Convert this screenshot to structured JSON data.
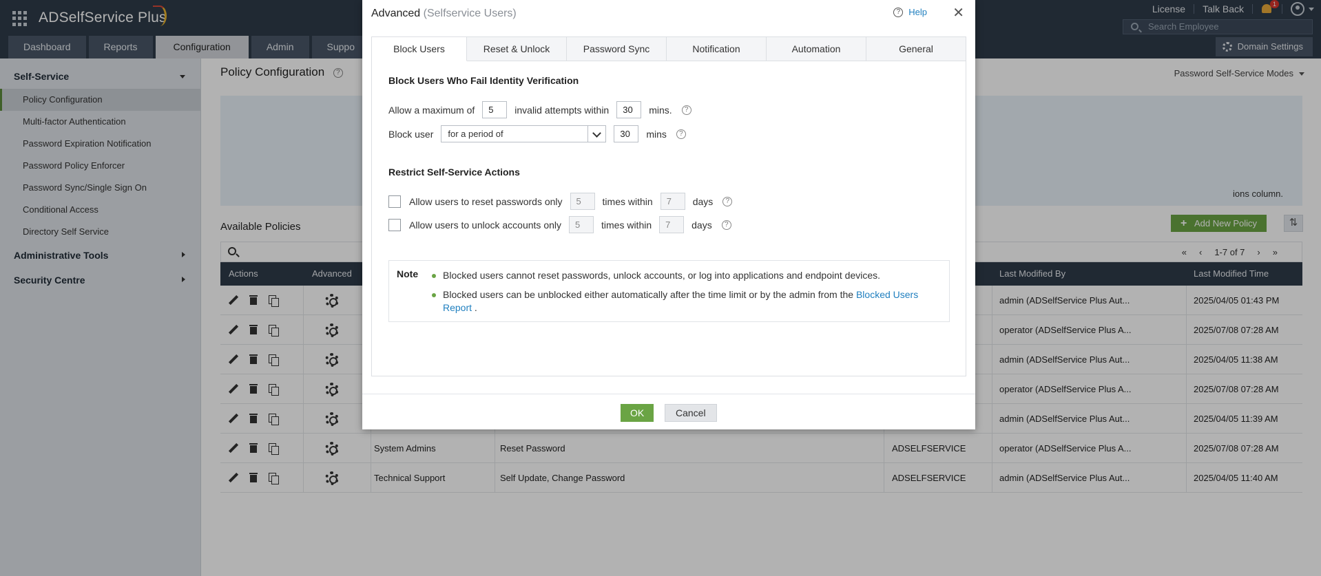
{
  "app": {
    "title": "ADSelfService Plus"
  },
  "topbar": {
    "links": [
      "License",
      "Talk Back"
    ],
    "notification_count": "1",
    "search_placeholder": "Search Employee",
    "tabs": [
      "Dashboard",
      "Reports",
      "Configuration",
      "Admin",
      "Suppo"
    ],
    "active_tab": "Configuration",
    "domain_settings": "Domain Settings"
  },
  "sidebar": {
    "self_service": "Self-Service",
    "items": [
      "Policy Configuration",
      "Multi-factor Authentication",
      "Password Expiration Notification",
      "Password Policy Enforcer",
      "Password Sync/Single Sign On",
      "Conditional Access",
      "Directory Self Service"
    ],
    "administrative_tools": "Administrative Tools",
    "security_centre": "Security Centre"
  },
  "main": {
    "title": "Policy Configuration",
    "modes_dropdown": "Password Self-Service Modes",
    "info_tail": "ions column.",
    "available_policies": "Available Policies",
    "add_policy": "Add New Policy",
    "pagination": "1-7 of 7",
    "columns": [
      "Actions",
      "Advanced",
      "Last Modified By",
      "Last Modified Time"
    ],
    "rows": [
      {
        "name": "",
        "features": "",
        "domain": "",
        "modified_by": "admin (ADSelfService Plus Aut...",
        "modified_time": "2025/04/05 01:43 PM"
      },
      {
        "name": "",
        "features": "",
        "domain": "",
        "modified_by": "operator (ADSelfService Plus A...",
        "modified_time": "2025/07/08 07:28 AM"
      },
      {
        "name": "",
        "features": "",
        "domain": "",
        "modified_by": "admin (ADSelfService Plus Aut...",
        "modified_time": "2025/04/05 11:38 AM"
      },
      {
        "name": "",
        "features": "",
        "domain": "",
        "modified_by": "operator (ADSelfService Plus A...",
        "modified_time": "2025/07/08 07:28 AM"
      },
      {
        "name": "",
        "features": "",
        "domain": "",
        "modified_by": "admin (ADSelfService Plus Aut...",
        "modified_time": "2025/04/05 11:39 AM"
      },
      {
        "name": "System Admins",
        "features": "Reset Password",
        "domain": "ADSELFSERVICE",
        "modified_by": "operator (ADSelfService Plus A...",
        "modified_time": "2025/07/08 07:28 AM"
      },
      {
        "name": "Technical Support",
        "features": "Self Update, Change Password",
        "domain": "ADSELFSERVICE",
        "modified_by": "admin (ADSelfService Plus Aut...",
        "modified_time": "2025/04/05 11:40 AM"
      }
    ]
  },
  "dialog": {
    "title": "Advanced",
    "subtitle": "(Selfservice Users)",
    "help": "Help",
    "tabs": [
      "Block Users",
      "Reset & Unlock",
      "Password Sync",
      "Notification",
      "Automation",
      "General"
    ],
    "active_tab": "Block Users",
    "block": {
      "heading": "Block Users Who Fail Identity Verification",
      "allow_prefix": "Allow a maximum of",
      "attempts": "5",
      "attempts_mid": "invalid attempts within",
      "minutes": "30",
      "mins_dot": "mins.",
      "block_user": "Block user",
      "period_option": "for a period of",
      "period_minutes": "30",
      "mins": "mins"
    },
    "restrict": {
      "heading": "Restrict Self-Service Actions",
      "reset_label": "Allow users to reset passwords only",
      "reset_times": "5",
      "times_within": "times within",
      "reset_days": "7",
      "days": "days",
      "unlock_label": "Allow users to unlock accounts only",
      "unlock_times": "5",
      "unlock_days": "7"
    },
    "note": {
      "label": "Note",
      "item1": "Blocked users cannot reset passwords, unlock accounts, or log into applications and endpoint devices.",
      "item2_prefix": "Blocked users can be unblocked either automatically after the time limit or by the admin from the",
      "item2_link": "Blocked Users Report",
      "item2_suffix": "."
    },
    "ok": "OK",
    "cancel": "Cancel"
  },
  "colors": {
    "accent_green": "#6aa444",
    "header_dark": "#2f3b4a",
    "link_blue": "#1f7fbf"
  }
}
